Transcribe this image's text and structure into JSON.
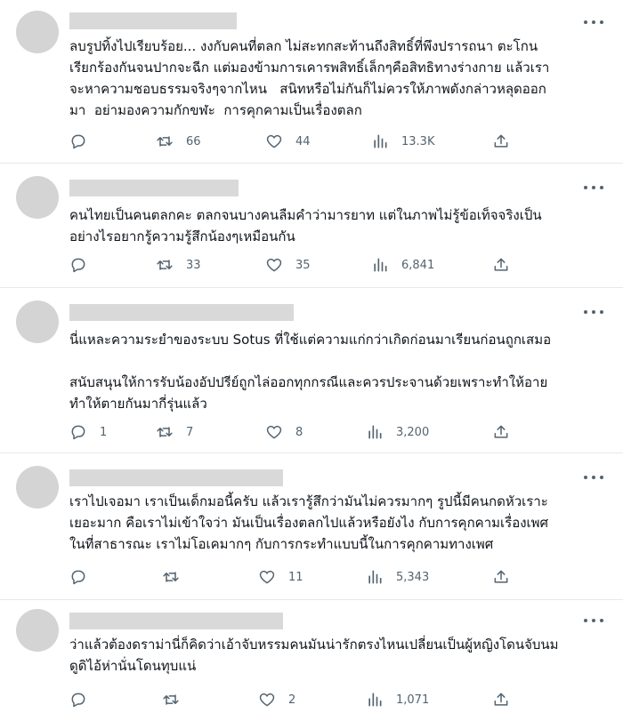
{
  "tweets": [
    {
      "text_lines": [
        "ลบรูปทิ้งไปเรียบร้อย... งงกับคนที่ตลก ไม่สะทกสะท้านถึงสิทธิ์ที่พึงปรารถนา ตะโกน",
        "เรียกร้องกันจนปากจะฉีก แต่มองข้ามการเคารพสิทธิ์เล็กๆคือสิทธิทางร่างกาย แล้วเรา",
        "จะหาความชอบธรรมจริงๆจากไหน   สนิทหรือไม่กันก็ไม่ควรให้ภาพดังกล่าวหลุดออก",
        "มา  อย่ามองความกักขฬะ  การคุกคามเป็นเรื่องตลก"
      ],
      "replies": "",
      "retweets": "66",
      "likes": "44",
      "views": "13.3K"
    },
    {
      "text_lines": [
        "คนไทยเป็นคนตลกคะ ตลกจนบางคนลืมคำว่ามารยาท แต่ในภาพไม่รู้ข้อเท็จจริงเป็น",
        "อย่างไรอยากรู้ความรู้สึกน้องๆเหมือนกัน"
      ],
      "replies": "",
      "retweets": "33",
      "likes": "35",
      "views": "6,841"
    },
    {
      "text_lines": [
        "นี่แหละความระยำของระบบ Sotus ที่ใช้แต่ความแก่กว่าเกิดก่อนมาเรียนก่อนถูกเสมอ",
        "",
        "สนับสนุนให้การรับน้องอัปปรีย์ถูกไล่ออกทุกกรณีและควรประจานด้วยเพราะทำให้อาย",
        "ทำให้ตายกันมากี่รุ่นแล้ว"
      ],
      "replies": "1",
      "retweets": "7",
      "likes": "8",
      "views": "3,200"
    },
    {
      "text_lines": [
        "เราไปเจอมา เราเป็นเด็กมอนี้ครับ แล้วเรารู้สึกว่ามันไม่ควรมากๆ รูปนี้มีคนกดหัวเราะ",
        "เยอะมาก คือเราไม่เข้าใจว่า มันเป็นเรื่องตลกไปแล้วหรือยังไง กับการคุกคามเรื่องเพศ",
        "ในที่สาธารณะ เราไม่โอเคมากๆ กับการกระทำแบบนี้ในการคุกคามทางเพศ"
      ],
      "replies": "",
      "retweets": "",
      "likes": "11",
      "views": "5,343"
    },
    {
      "text_lines": [
        "ว่าแล้วต้องดราม่านี่ก็คิดว่าเอ้าจับหรรมคนมันน่ารักตรงไหนเปลี่ยนเป็นผู้หญิงโดนจับนม",
        "ดูดิไอ้ห่านั่นโดนทุบแน่"
      ],
      "replies": "",
      "retweets": "",
      "likes": "2",
      "views": "1,071"
    }
  ],
  "colors": {
    "text": "#0f1419",
    "muted": "#536471",
    "avatar": "#d4d4d4",
    "redacted": "#d9d9d9",
    "divider": "#e6e8ea"
  },
  "icons": [
    "reply-icon",
    "retweet-icon",
    "like-icon",
    "views-icon",
    "share-icon",
    "more-icon"
  ]
}
